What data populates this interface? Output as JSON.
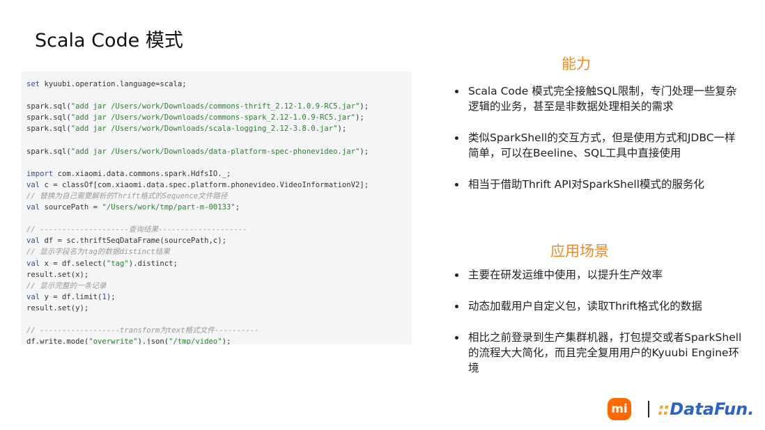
{
  "slide": {
    "title": "Scala Code 模式"
  },
  "code": {
    "lines": [
      [
        {
          "t": "kw",
          "v": "set "
        },
        {
          "t": "id",
          "v": "kyuubi.operation.language=scala;"
        }
      ],
      [],
      [
        {
          "t": "id",
          "v": "spark.sql("
        },
        {
          "t": "str",
          "v": "\"add jar /Users/work/Downloads/commons-thrift_2.12-1.0.9-RC5.jar\""
        },
        {
          "t": "id",
          "v": ");"
        }
      ],
      [
        {
          "t": "id",
          "v": "spark.sql("
        },
        {
          "t": "str",
          "v": "\"add jar /Users/work/Downloads/commons-spark_2.12-1.0.9-RC5.jar\""
        },
        {
          "t": "id",
          "v": ");"
        }
      ],
      [
        {
          "t": "id",
          "v": "spark.sql("
        },
        {
          "t": "str",
          "v": "\"add jar /Users/work/Downloads/scala-logging_2.12-3.8.0.jar\""
        },
        {
          "t": "id",
          "v": ");"
        }
      ],
      [],
      [
        {
          "t": "id",
          "v": "spark.sql("
        },
        {
          "t": "str",
          "v": "\"add jar /Users/work/Downloads/data-platform-spec-phonevideo.jar\""
        },
        {
          "t": "id",
          "v": ");"
        }
      ],
      [],
      [
        {
          "t": "kw",
          "v": "import "
        },
        {
          "t": "id",
          "v": "com.xiaomi.data.commons.spark.HdfsIO._;"
        }
      ],
      [
        {
          "t": "kw",
          "v": "val "
        },
        {
          "t": "id",
          "v": "c = classOf[com.xiaomi.data.spec.platform.phonevideo.VideoInformationV2];"
        }
      ],
      [
        {
          "t": "cm",
          "v": "// 替换为自己需要解析的Thrift格式的Sequence文件路径"
        }
      ],
      [
        {
          "t": "kw",
          "v": "val "
        },
        {
          "t": "id",
          "v": "sourcePath = "
        },
        {
          "t": "str",
          "v": "\"/Users/work/tmp/part-m-00133\""
        },
        {
          "t": "id",
          "v": ";"
        }
      ],
      [],
      [
        {
          "t": "cm",
          "v": "// --------------------查询结果--------------------"
        }
      ],
      [
        {
          "t": "kw",
          "v": "val "
        },
        {
          "t": "id",
          "v": "df = sc.thriftSeqDataFrame(sourcePath,c);"
        }
      ],
      [
        {
          "t": "cm",
          "v": "// 显示字段名为tag的数据distinct结果"
        }
      ],
      [
        {
          "t": "kw",
          "v": "val "
        },
        {
          "t": "id",
          "v": "x = df.select("
        },
        {
          "t": "str",
          "v": "\"tag\""
        },
        {
          "t": "id",
          "v": ").distinct;"
        }
      ],
      [
        {
          "t": "id",
          "v": "result.set(x);"
        }
      ],
      [
        {
          "t": "cm",
          "v": "// 显示完整的一条记录"
        }
      ],
      [
        {
          "t": "kw",
          "v": "val "
        },
        {
          "t": "id",
          "v": "y = df.limit("
        },
        {
          "t": "num",
          "v": "1"
        },
        {
          "t": "id",
          "v": ");"
        }
      ],
      [
        {
          "t": "id",
          "v": "result.set(y);"
        }
      ],
      [],
      [
        {
          "t": "cm",
          "v": "// ------------------transform为text格式文件----------"
        }
      ],
      [
        {
          "t": "id",
          "v": "df.write.mode("
        },
        {
          "t": "str",
          "v": "\"overwrite\""
        },
        {
          "t": "id",
          "v": ").json("
        },
        {
          "t": "str",
          "v": "\"/tmp/video\""
        },
        {
          "t": "id",
          "v": ");"
        }
      ]
    ]
  },
  "sections": {
    "ability": {
      "heading": "能力",
      "items": [
        "Scala Code 模式完全接触SQL限制，专门处理一些复杂逻辑的业务，甚至是非数据处理相关的需求",
        "类似SparkShell的交互方式，但是使用方式和JDBC一样简单，可以在Beeline、SQL工具中直接使用",
        "相当于借助Thrift API对SparkShell模式的服务化"
      ]
    },
    "scenarios": {
      "heading": "应用场景",
      "items": [
        "主要在研发运维中使用，以提升生产效率",
        "动态加载用户自定义包，读取Thrift格式化的数据",
        "相比之前登录到生产集群机器，打包提交或者SparkShell的流程大大简化，而且完全复用用户的Kyuubi Engine环境"
      ]
    }
  },
  "logos": {
    "mi": "mi",
    "divider": "|",
    "datafun_dots": "::",
    "datafun": "DataFun."
  },
  "colors": {
    "accent_orange": "#f08a24",
    "mi_orange": "#ff6900",
    "datafun_blue": "#2a63c9"
  }
}
